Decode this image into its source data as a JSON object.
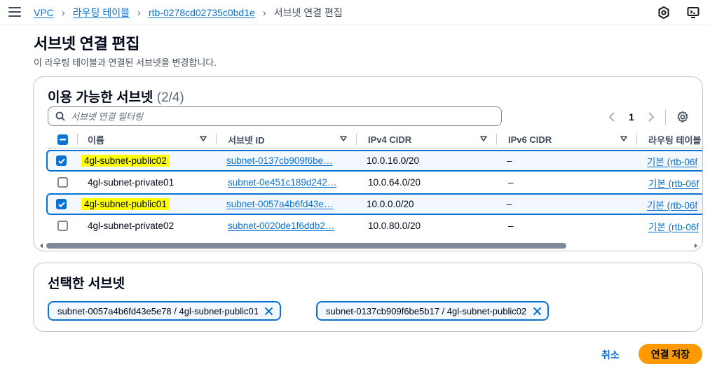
{
  "breadcrumb": {
    "vpc": "VPC",
    "route_tables": "라우팅 테이블",
    "rtb_id": "rtb-0278cd02735c0bd1e",
    "current": "서브넷 연결 편집"
  },
  "page": {
    "title": "서브넷 연결 편집",
    "description": "이 라우팅 테이블과 연결된 서브넷을 변경합니다."
  },
  "available": {
    "title": "이용 가능한 서브넷",
    "count": "(2/4)",
    "filter_placeholder": "서브넷 연결 필터링",
    "page_number": "1",
    "columns": {
      "name": "이름",
      "subnet_id": "서브넷 ID",
      "ipv4": "IPv4 CIDR",
      "ipv6": "IPv6 CIDR",
      "route_table": "라우팅 테이블"
    },
    "rows": [
      {
        "name": "4gl-subnet-public02",
        "subnet_id": "subnet-0137cb909f6be…",
        "ipv4": "10.0.16.0/20",
        "ipv6": "–",
        "route_table": "기본 (rtb-06f",
        "checked": true
      },
      {
        "name": "4gl-subnet-private01",
        "subnet_id": "subnet-0e451c189d242…",
        "ipv4": "10.0.64.0/20",
        "ipv6": "–",
        "route_table": "기본 (rtb-06f",
        "checked": false
      },
      {
        "name": "4gl-subnet-public01",
        "subnet_id": "subnet-0057a4b6fd43e…",
        "ipv4": "10.0.0.0/20",
        "ipv6": "–",
        "route_table": "기본 (rtb-06f",
        "checked": true
      },
      {
        "name": "4gl-subnet-private02",
        "subnet_id": "subnet-0020de1f6ddb2…",
        "ipv4": "10.0.80.0/20",
        "ipv6": "–",
        "route_table": "기본 (rtb-06f",
        "checked": false
      }
    ]
  },
  "selected": {
    "title": "선택한 서브넷",
    "tokens": [
      "subnet-0057a4b6fd43e5e78 / 4gl-subnet-public01",
      "subnet-0137cb909f6be5b17 / 4gl-subnet-public02"
    ]
  },
  "actions": {
    "cancel": "취소",
    "save": "연결 저장"
  },
  "colors": {
    "accent": "#0972d3",
    "primary_button": "#ff9900",
    "highlight": "#ffff00"
  },
  "icons": [
    "menu-icon",
    "chevron-right-icon",
    "notifications-icon",
    "cloudshell-icon",
    "search-icon",
    "chevron-left-icon",
    "gear-icon",
    "sort-caret-icon",
    "check-icon",
    "close-icon"
  ]
}
